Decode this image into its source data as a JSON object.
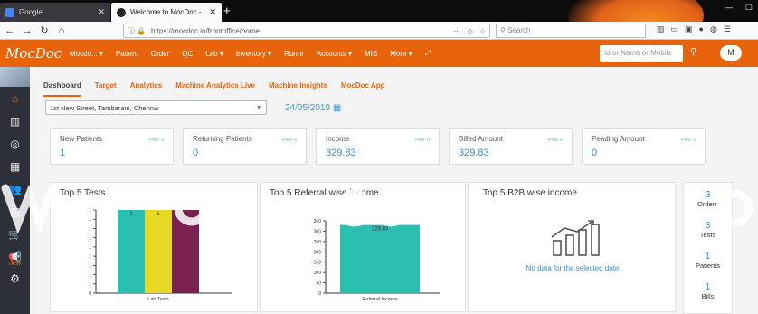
{
  "browser": {
    "tabs": [
      {
        "title": "Google"
      },
      {
        "title": "Welcome to MocDoc - One St"
      }
    ],
    "url": "https://mocdoc.in/frontoffice/home",
    "search_placeholder": "Search"
  },
  "app": {
    "logo": "MocDoc",
    "menu": [
      "Mocdo...",
      "Patient",
      "Order",
      "QC",
      "Lab",
      "Inventory",
      "Runnr",
      "Accounts",
      "MIS",
      "More"
    ],
    "search_placeholder": "Id or Name or Mobile",
    "avatar": "M"
  },
  "sidebar": {
    "new_label": "new"
  },
  "dashboard": {
    "tabs": [
      "Dashboard",
      "Target",
      "Analytics",
      "Machine Analytics Live",
      "Machine Insights",
      "MocDoc App"
    ],
    "location": "1st New Street, Tambaram, Chennai",
    "date": "24/05/2019",
    "cards": [
      {
        "label": "New Patients",
        "prev": "Prev: 0",
        "value": "1"
      },
      {
        "label": "Returning Patients",
        "prev": "Prev: 0",
        "value": "0"
      },
      {
        "label": "Income",
        "prev": "Prev: 0",
        "value": "329.83"
      },
      {
        "label": "Billed Amount",
        "prev": "Prev: 0",
        "value": "329.83"
      },
      {
        "label": "Pending Amount",
        "prev": "Prev: 0",
        "value": "0"
      }
    ],
    "panels": {
      "tests_title": "Top 5 Tests",
      "referral_title": "Top 5 Referral wise income",
      "b2b_title": "Top 5 B2B wise income",
      "b2b_nodata": "No data for the selected date"
    },
    "summary": [
      {
        "value": "3",
        "label": "Orders"
      },
      {
        "value": "3",
        "label": "Tests"
      },
      {
        "value": "1",
        "label": "Patients"
      },
      {
        "value": "1",
        "label": "Bills"
      }
    ]
  },
  "chart_data": [
    {
      "type": "bar",
      "categories": [
        "Lab Tests"
      ],
      "series": [
        {
          "values": [
            1
          ],
          "color": "#2bbfb0"
        },
        {
          "values": [
            1
          ],
          "color": "#e5d925"
        },
        {
          "values": [
            1
          ],
          "color": "#7b2150"
        }
      ],
      "y_ticks": [
        "1",
        "1",
        "1",
        "1",
        "1",
        "1",
        "1",
        "1",
        "1",
        "0"
      ],
      "xlabel": "Lab Tests",
      "ylim": [
        0,
        1
      ]
    },
    {
      "type": "bar",
      "categories": [
        "Referral Income"
      ],
      "values": [
        329.83
      ],
      "color": "#2bbfb0",
      "y_ticks": [
        "350",
        "300",
        "250",
        "200",
        "150",
        "100",
        "50",
        "0"
      ],
      "data_label": "329.83",
      "xlabel": "Referral Income",
      "ylim": [
        0,
        350
      ]
    }
  ]
}
